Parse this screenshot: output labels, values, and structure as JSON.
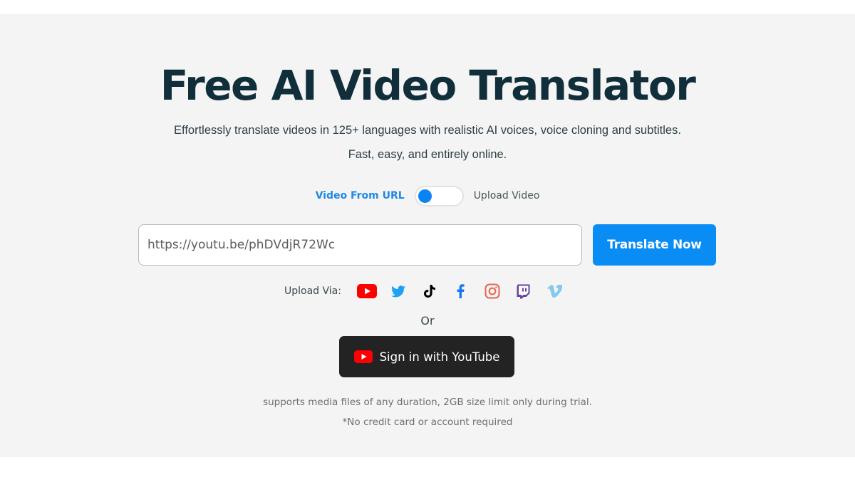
{
  "hero": {
    "title": "Free AI Video Translator",
    "subtitle_line1": "Effortlessly translate videos in 125+ languages with realistic AI voices, voice cloning and subtitles.",
    "subtitle_line2": "Fast, easy, and entirely online."
  },
  "mode_toggle": {
    "left_label": "Video From URL",
    "right_label": "Upload Video",
    "selected": "Video From URL"
  },
  "url_input": {
    "value": "https://youtu.be/phDVdjR72Wc"
  },
  "translate_button": {
    "label": "Translate Now"
  },
  "upload_via": {
    "label": "Upload Via:",
    "platforms": [
      {
        "name": "YouTube",
        "icon": "youtube-icon",
        "color": "#ff0000"
      },
      {
        "name": "Twitter",
        "icon": "twitter-icon",
        "color": "#1da1f2"
      },
      {
        "name": "TikTok",
        "icon": "tiktok-icon",
        "color": "#000000"
      },
      {
        "name": "Facebook",
        "icon": "facebook-icon",
        "color": "#1877f2"
      },
      {
        "name": "Instagram",
        "icon": "instagram-icon",
        "color": "#e4664f"
      },
      {
        "name": "Twitch",
        "icon": "twitch-icon",
        "color": "#6441a5"
      },
      {
        "name": "Vimeo",
        "icon": "vimeo-icon",
        "color": "#86c9ef"
      }
    ]
  },
  "or_label": "Or",
  "youtube_signin": {
    "label": "Sign in with YouTube"
  },
  "notes": {
    "line1": "supports media files of any duration, 2GB size limit only during trial.",
    "line2": "*No credit card or account required"
  },
  "colors": {
    "accent": "#0a8cf5",
    "title": "#102f3b",
    "background": "#f4f4f4"
  }
}
